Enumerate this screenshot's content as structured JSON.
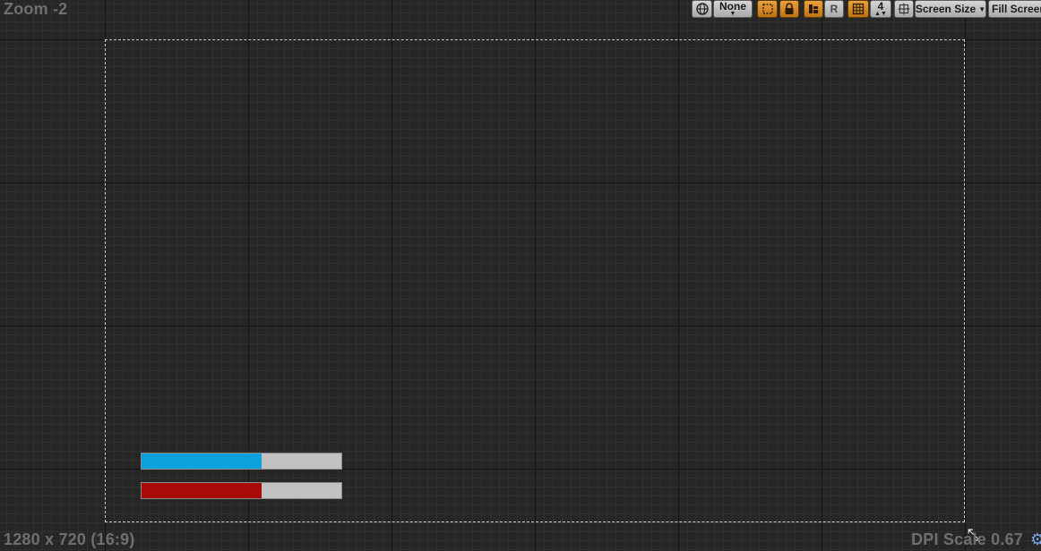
{
  "viewport": {
    "zoom_label": "Zoom -2",
    "resolution_label": "1280 x 720 (16:9)",
    "dpi_label": "DPI Scale 0.67"
  },
  "toolbar": {
    "localization_icon": "globe-icon",
    "localization_value": "None",
    "snap_icon": "frame-icon",
    "lock_icon": "lock-icon",
    "wrap_icon": "layout-icon",
    "respect_locks_label": "R",
    "grid_icon": "grid-icon",
    "grid_size_value": "4",
    "transform_icon": "transform-icon",
    "screen_size_label": "Screen Size",
    "fill_screen_label": "Fill Screen"
  },
  "widgets": {
    "bars": [
      {
        "name": "mana-bar",
        "percent": 0.6,
        "fill_color": "#0ca0dc",
        "track_color": "#c2c2c2"
      },
      {
        "name": "health-bar",
        "percent": 0.6,
        "fill_color": "#a80a0a",
        "track_color": "#c2c2c2"
      }
    ]
  },
  "colors": {
    "background": "#262626",
    "accent_orange": "#d88b24",
    "frame_outline": "#d0d0d0"
  }
}
